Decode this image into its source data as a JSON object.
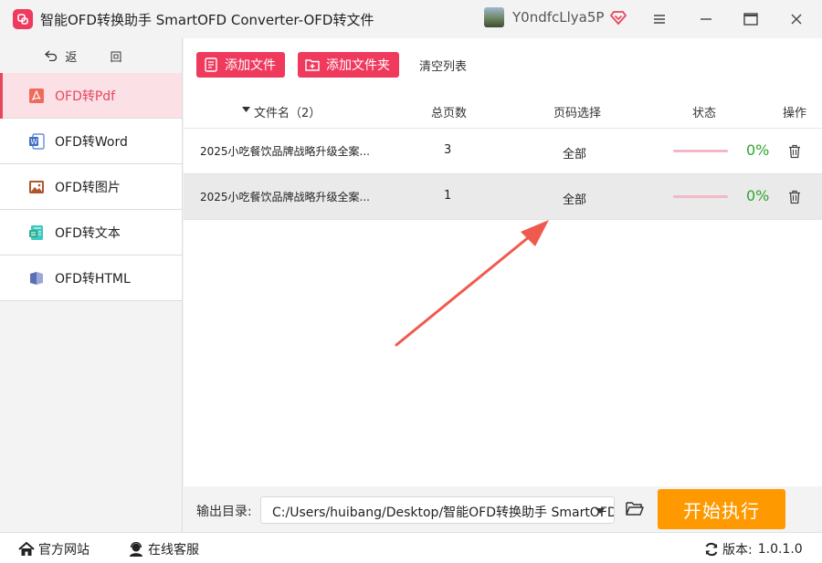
{
  "app": {
    "title": "智能OFD转换助手 SmartOFD Converter-OFD转文件",
    "username": "Y0ndfcLlya5P",
    "accent": "#ef3a5d"
  },
  "sidebar": {
    "back_label": "返 回",
    "items": [
      {
        "label": "OFD转Pdf",
        "icon": "pdf-icon",
        "active": true
      },
      {
        "label": "OFD转Word",
        "icon": "word-icon"
      },
      {
        "label": "OFD转图片",
        "icon": "image-icon"
      },
      {
        "label": "OFD转文本",
        "icon": "text-icon"
      },
      {
        "label": "OFD转HTML",
        "icon": "html-icon"
      }
    ]
  },
  "toolbar": {
    "add_file": "添加文件",
    "add_folder": "添加文件夹",
    "clear_list": "清空列表"
  },
  "table": {
    "headers": {
      "name": "文件名（2）",
      "pages": "总页数",
      "range": "页码选择",
      "status": "状态",
      "action": "操作"
    },
    "rows": [
      {
        "name": "2025小吃餐饮品牌战略升级全案...",
        "pages": "3",
        "range": "全部",
        "progress": "0%",
        "progress_value": 0
      },
      {
        "name": "2025小吃餐饮品牌战略升级全案...",
        "pages": "1",
        "range": "全部",
        "progress": "0%",
        "progress_value": 0
      }
    ]
  },
  "output": {
    "label": "输出目录:",
    "path": "C:/Users/huibang/Desktop/智能OFD转换助手 SmartOFD",
    "start": "开始执行"
  },
  "footer": {
    "website": "官方网站",
    "support": "在线客服",
    "version_label": "版本:",
    "version": "1.0.1.0"
  }
}
